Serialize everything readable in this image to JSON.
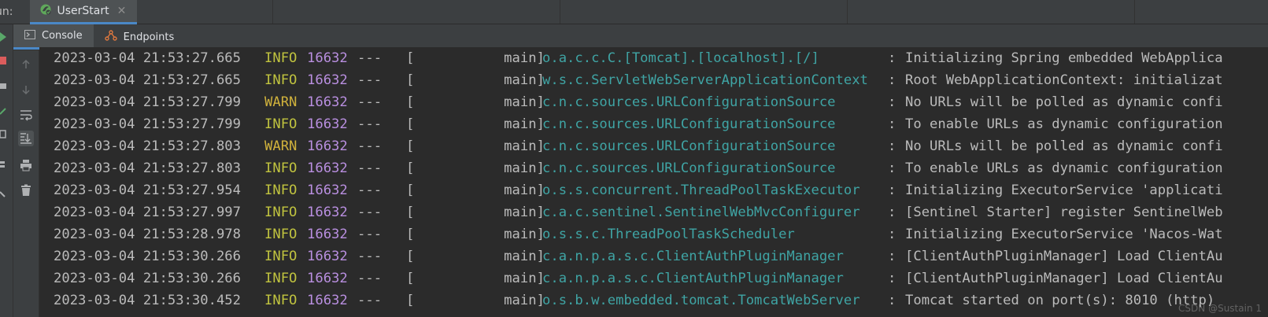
{
  "run_bar": {
    "label": "un:",
    "tab_label": "UserStart",
    "close_glyph": "✕"
  },
  "sub_tabs": [
    {
      "label": "Console",
      "icon": "console-icon",
      "active": true
    },
    {
      "label": "Endpoints",
      "icon": "endpoints-icon",
      "active": false
    }
  ],
  "gutter_icons": [
    "arrow-up-icon",
    "arrow-down-icon",
    "soft-wrap-icon",
    "scroll-to-end-icon",
    "print-icon",
    "trash-icon"
  ],
  "colors": {
    "info": "#c0c33f",
    "warn": "#d0b23c",
    "pid": "#b98fe0",
    "logger": "#3fa4a4",
    "accent": "#4a88c7"
  },
  "log_lines": [
    {
      "ts": "2023-03-04 21:53:27.665",
      "level": "INFO",
      "pid": "16632",
      "sep": "---",
      "thread": "[           main]",
      "logger": "o.a.c.c.C.[Tomcat].[localhost].[/]",
      "colon": ":",
      "msg": "Initializing Spring embedded WebApplica"
    },
    {
      "ts": "2023-03-04 21:53:27.665",
      "level": "INFO",
      "pid": "16632",
      "sep": "---",
      "thread": "[           main]",
      "logger": "w.s.c.ServletWebServerApplicationContext",
      "colon": ":",
      "msg": "Root WebApplicationContext: initializat"
    },
    {
      "ts": "2023-03-04 21:53:27.799",
      "level": "WARN",
      "pid": "16632",
      "sep": "---",
      "thread": "[           main]",
      "logger": "c.n.c.sources.URLConfigurationSource",
      "colon": ":",
      "msg": "No URLs will be polled as dynamic confi"
    },
    {
      "ts": "2023-03-04 21:53:27.799",
      "level": "INFO",
      "pid": "16632",
      "sep": "---",
      "thread": "[           main]",
      "logger": "c.n.c.sources.URLConfigurationSource",
      "colon": ":",
      "msg": "To enable URLs as dynamic configuration"
    },
    {
      "ts": "2023-03-04 21:53:27.803",
      "level": "WARN",
      "pid": "16632",
      "sep": "---",
      "thread": "[           main]",
      "logger": "c.n.c.sources.URLConfigurationSource",
      "colon": ":",
      "msg": "No URLs will be polled as dynamic confi"
    },
    {
      "ts": "2023-03-04 21:53:27.803",
      "level": "INFO",
      "pid": "16632",
      "sep": "---",
      "thread": "[           main]",
      "logger": "c.n.c.sources.URLConfigurationSource",
      "colon": ":",
      "msg": "To enable URLs as dynamic configuration"
    },
    {
      "ts": "2023-03-04 21:53:27.954",
      "level": "INFO",
      "pid": "16632",
      "sep": "---",
      "thread": "[           main]",
      "logger": "o.s.s.concurrent.ThreadPoolTaskExecutor",
      "colon": ":",
      "msg": "Initializing ExecutorService 'applicati"
    },
    {
      "ts": "2023-03-04 21:53:27.997",
      "level": "INFO",
      "pid": "16632",
      "sep": "---",
      "thread": "[           main]",
      "logger": "c.a.c.sentinel.SentinelWebMvcConfigurer",
      "colon": ":",
      "msg": "[Sentinel Starter] register SentinelWeb"
    },
    {
      "ts": "2023-03-04 21:53:28.978",
      "level": "INFO",
      "pid": "16632",
      "sep": "---",
      "thread": "[           main]",
      "logger": "o.s.s.c.ThreadPoolTaskScheduler",
      "colon": ":",
      "msg": "Initializing ExecutorService 'Nacos-Wat"
    },
    {
      "ts": "2023-03-04 21:53:30.266",
      "level": "INFO",
      "pid": "16632",
      "sep": "---",
      "thread": "[           main]",
      "logger": "c.a.n.p.a.s.c.ClientAuthPluginManager",
      "colon": ":",
      "msg": "[ClientAuthPluginManager] Load ClientAu"
    },
    {
      "ts": "2023-03-04 21:53:30.266",
      "level": "INFO",
      "pid": "16632",
      "sep": "---",
      "thread": "[           main]",
      "logger": "c.a.n.p.a.s.c.ClientAuthPluginManager",
      "colon": ":",
      "msg": "[ClientAuthPluginManager] Load ClientAu"
    },
    {
      "ts": "2023-03-04 21:53:30.452",
      "level": "INFO",
      "pid": "16632",
      "sep": "---",
      "thread": "[           main]",
      "logger": "o.s.b.w.embedded.tomcat.TomcatWebServer",
      "colon": ":",
      "msg": "Tomcat started on port(s): 8010 (http)"
    }
  ],
  "watermark": "CSDN @Sustain 1"
}
